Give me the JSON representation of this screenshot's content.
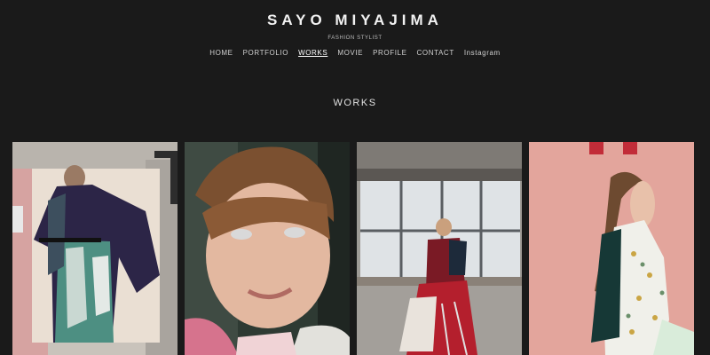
{
  "header": {
    "title": "SAYO MIYAJIMA",
    "subtitle": "FASHION STYLIST"
  },
  "nav": {
    "items": [
      {
        "label": "HOME",
        "active": false
      },
      {
        "label": "PORTFOLIO",
        "active": false
      },
      {
        "label": "WORKS",
        "active": true
      },
      {
        "label": "MOVIE",
        "active": false
      },
      {
        "label": "PROFILE",
        "active": false
      },
      {
        "label": "CONTACT",
        "active": false
      },
      {
        "label": "Instagram",
        "active": false
      }
    ]
  },
  "main": {
    "heading": "WORKS",
    "works": [
      {
        "subject": "model in navy kimono-sleeve jacket and floral patchwork dress"
      },
      {
        "subject": "close-up portrait with glitter eye makeup"
      },
      {
        "subject": "model seated by window in red ruffled dress"
      },
      {
        "subject": "model in profile wearing floral print dress against pink wall"
      }
    ]
  },
  "colors": {
    "background": "#1a1a1a",
    "text": "#e6e6e6"
  }
}
